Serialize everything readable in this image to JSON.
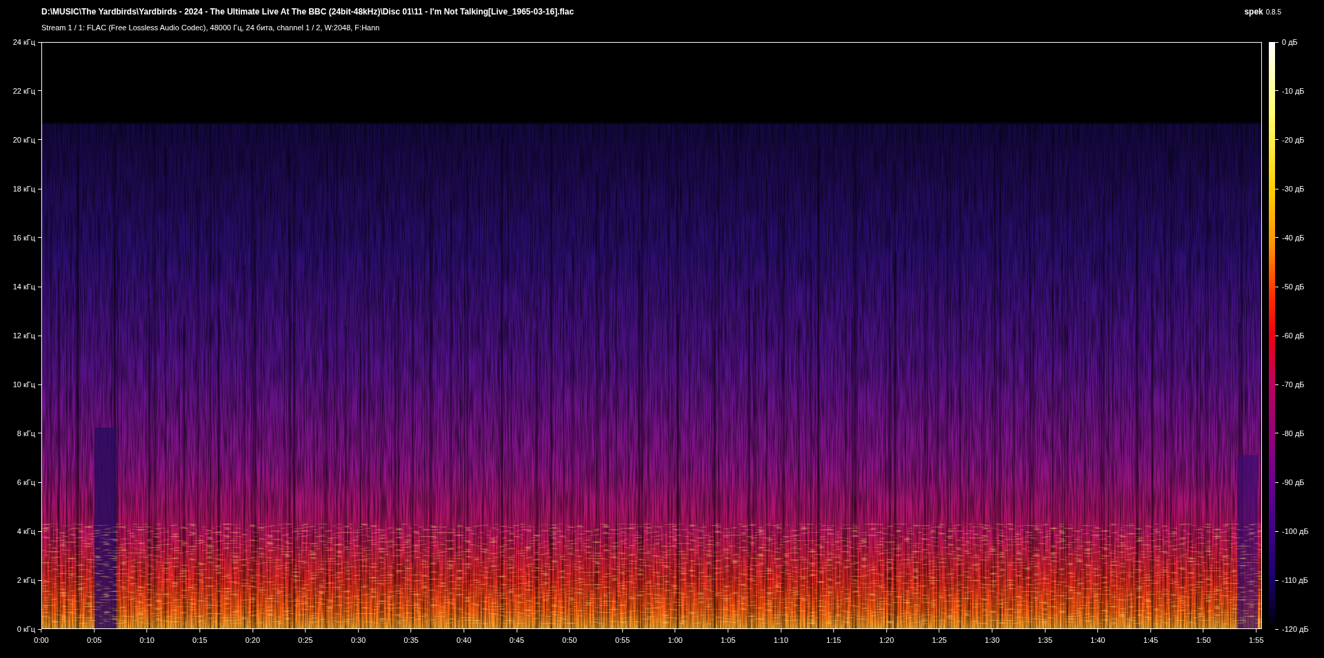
{
  "title": "D:\\MUSIC\\The Yardbirds\\Yardbirds - 2024 - The Ultimate Live At The BBC (24bit-48kHz)\\Disc 01\\11 - I'm Not Talking[Live_1965-03-16].flac",
  "app": {
    "name": "spek",
    "version": "0.8.5"
  },
  "stream_info": "Stream 1 / 1: FLAC (Free Lossless Audio Codec), 48000 Гц, 24 бита, channel 1 / 2, W:2048, F:Hann",
  "frequency_axis": {
    "labels": [
      "24 кГц",
      "22 кГц",
      "20 кГц",
      "18 кГц",
      "16 кГц",
      "14 кГц",
      "12 кГц",
      "10 кГц",
      "8 кГц",
      "6 кГц",
      "4 кГц",
      "2 кГц",
      "0 кГц"
    ]
  },
  "time_axis": {
    "labels": [
      "0:00",
      "0:05",
      "0:10",
      "0:15",
      "0:20",
      "0:25",
      "0:30",
      "0:35",
      "0:40",
      "0:45",
      "0:50",
      "0:55",
      "1:00",
      "1:05",
      "1:10",
      "1:15",
      "1:20",
      "1:25",
      "1:30",
      "1:35",
      "1:40",
      "1:45",
      "1:50",
      "1:55"
    ]
  },
  "level_legend": {
    "labels": [
      "0 дБ",
      "-10 дБ",
      "-20 дБ",
      "-30 дБ",
      "-40 дБ",
      "-50 дБ",
      "-60 дБ",
      "-70 дБ",
      "-80 дБ",
      "-90 дБ",
      "-100 дБ",
      "-110 дБ",
      "-120 дБ"
    ]
  }
}
